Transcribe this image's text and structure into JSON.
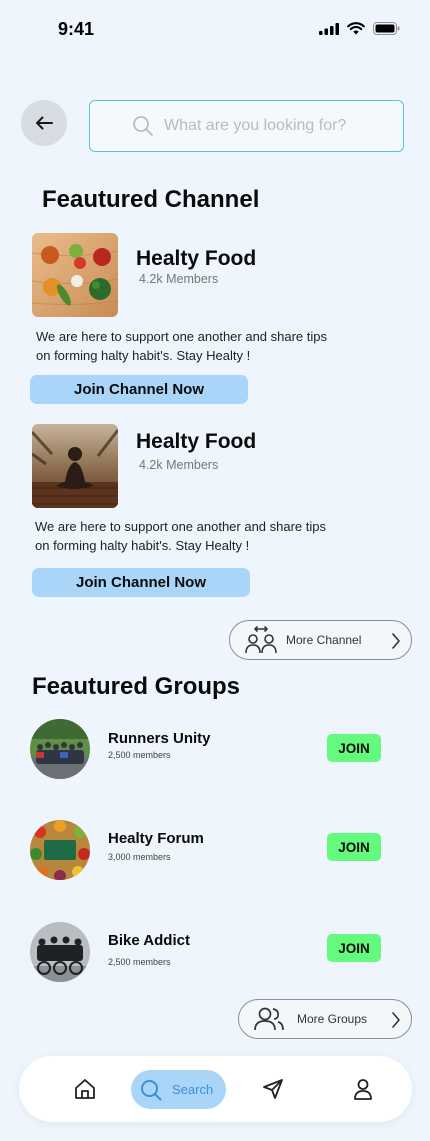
{
  "status_bar": {
    "time": "9:41"
  },
  "search": {
    "placeholder": "What are you looking for?"
  },
  "featured_channels": {
    "title": "Feautured Channel",
    "items": [
      {
        "name": "Healty Food",
        "members": "4.2k Members",
        "description": "We are here to support one another and share tips on forming halty habit's. Stay Healty !",
        "button": "Join Channel Now"
      },
      {
        "name": "Healty Food",
        "members": "4.2k Members",
        "description": "We are here to support one another and share tips on forming halty habit's. Stay Healty !",
        "button": "Join Channel Now"
      }
    ],
    "more_label": "More Channel"
  },
  "featured_groups": {
    "title": "Feautured Groups",
    "items": [
      {
        "name": "Runners Unity",
        "members": "2,500 members",
        "button": "JOIN"
      },
      {
        "name": "Healty Forum",
        "members": "3,000 members",
        "button": "JOIN"
      },
      {
        "name": "Bike Addict",
        "members": "2,500 members",
        "button": "JOIN"
      }
    ],
    "more_label": "More Groups"
  },
  "bottom_nav": {
    "search_label": "Search"
  },
  "colors": {
    "accent": "#a9d6f8",
    "join": "#63fa7d",
    "background": "#eef5fd",
    "search_border": "#56c7d9"
  },
  "icons": [
    "back-arrow-icon",
    "search-icon",
    "channel-people-icon",
    "chevron-right-icon",
    "groups-people-icon",
    "home-icon",
    "send-icon",
    "profile-icon"
  ]
}
